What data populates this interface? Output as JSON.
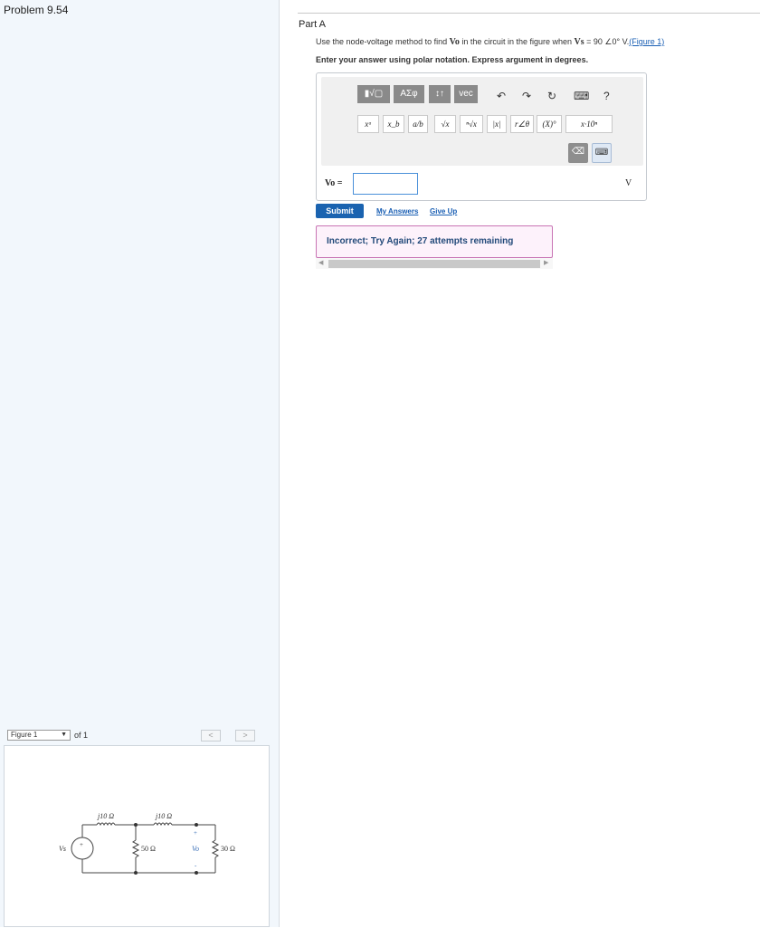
{
  "left": {
    "problem_title": "Problem 9.54",
    "figure_select": "Figure 1",
    "figure_of": "of 1",
    "nav_prev": "<",
    "nav_next": ">"
  },
  "circuit": {
    "source_label": "Vs",
    "source_sign": "+",
    "inductor1": "j10 Ω",
    "inductor2": "j10 Ω",
    "resistor1": "50 Ω",
    "resistor2": "30 Ω",
    "output_label": "Vo",
    "plus": "+",
    "minus": "-"
  },
  "part": {
    "title": "Part A",
    "question_prefix": "Use the node-voltage method to find ",
    "vo": "Vo",
    "question_mid": " in the circuit in the figure when ",
    "vs": "Vs",
    "question_val": " = 90 ∠0° V.",
    "figure_link": "(Figure 1)",
    "instruction": "Enter your answer using polar notation. Express argument in degrees."
  },
  "toolbar": {
    "templates": "▮√▢",
    "greek": "ΑΣφ",
    "arrows": "↕↑",
    "vec": "vec",
    "undo": "↶",
    "redo": "↷",
    "reset": "↻",
    "keyboard": "⌨",
    "help": "?",
    "fmt": [
      "xᵃ",
      "x_b",
      "a/b",
      "√x",
      "ⁿ√x",
      "|x|",
      "r∠θ",
      "(X)°",
      "x·10ⁿ"
    ],
    "delete": "⌫",
    "keypad": "⌨"
  },
  "answer": {
    "label": "Vo =",
    "value": "",
    "unit": "V"
  },
  "actions": {
    "submit": "Submit",
    "my_answers": "My Answers",
    "give_up": "Give Up"
  },
  "feedback": {
    "text": "Incorrect; Try Again; 27 attempts remaining"
  }
}
